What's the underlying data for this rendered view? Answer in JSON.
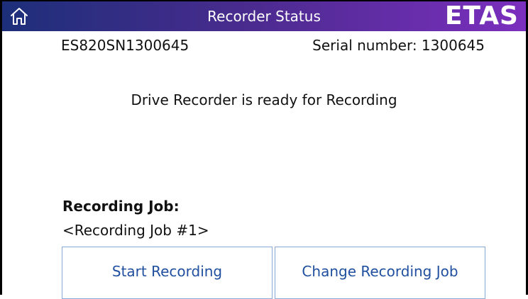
{
  "header": {
    "title": "Recorder Status",
    "logo_text": "ETAS",
    "home_icon": "home-icon",
    "gradient_start": "#1d2f7a",
    "gradient_end": "#7b2fbe"
  },
  "device": {
    "id": "ES820SN1300645",
    "serial_label": "Serial number: 1300645"
  },
  "status": {
    "message": "Drive Recorder is ready for Recording"
  },
  "recording_job": {
    "heading": "Recording Job:",
    "name": "<Recording Job #1>"
  },
  "actions": {
    "start_label": "Start Recording",
    "change_label": "Change Recording Job",
    "button_text_color": "#1f4f9e",
    "button_border_color": "#8aa9d6"
  }
}
